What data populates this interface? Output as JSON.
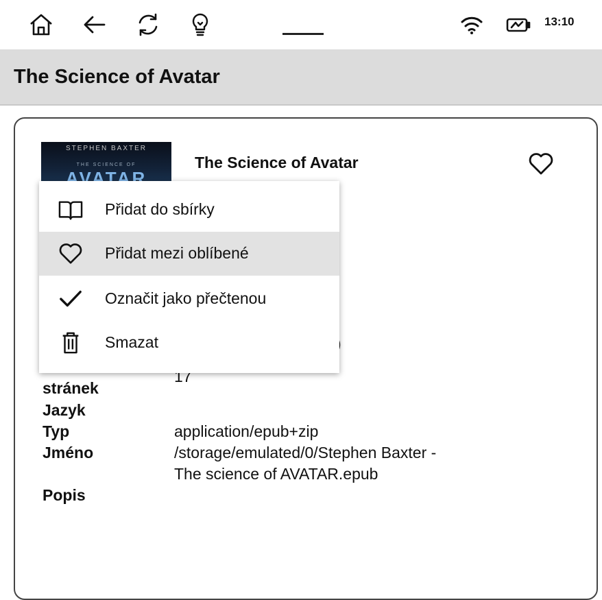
{
  "statusbar": {
    "clock": "13:10",
    "icons": [
      "home-icon",
      "back-arrow-icon",
      "refresh-icon",
      "lightbulb-icon",
      "wifi-icon",
      "battery-charging-icon"
    ]
  },
  "header": {
    "title": "The Science of Avatar"
  },
  "book": {
    "title": "The Science of Avatar",
    "cover": {
      "author": "STEPHEN BAXTER",
      "subtitle": "THE SCIENCE OF",
      "name": "AVATAR"
    },
    "partial_value_1": ")",
    "partial_value_2": "17"
  },
  "details": {
    "pages_label": "stránek",
    "language_label": "Jazyk",
    "type_label": "Typ",
    "type_value": "application/epub+zip",
    "name_label": "Jméno",
    "name_value_line1": "/storage/emulated/0/Stephen Baxter -",
    "name_value_line2": "The science of AVATAR.epub",
    "description_label": "Popis"
  },
  "menu": {
    "items": [
      {
        "label": "Přidat do sbírky",
        "icon": "book-open-icon"
      },
      {
        "label": "Přidat mezi oblíbené",
        "icon": "heart-icon"
      },
      {
        "label": "Označit jako přečtenou",
        "icon": "checkmark-icon"
      },
      {
        "label": "Smazat",
        "icon": "trash-icon"
      }
    ]
  }
}
